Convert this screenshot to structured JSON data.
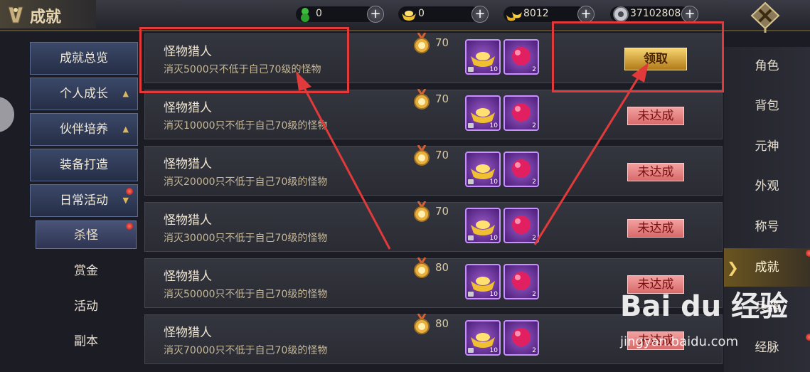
{
  "header": {
    "title": "成就",
    "currencies": [
      {
        "icon": "green-gourd-icon",
        "value": "0"
      },
      {
        "icon": "gold-ingot-icon",
        "value": "0"
      },
      {
        "icon": "gold-ingots-stack-icon",
        "value": "8012"
      },
      {
        "icon": "silver-coin-icon",
        "value": "37102808"
      }
    ],
    "plus_label": "+"
  },
  "left_nav": [
    {
      "label": "成就总览"
    },
    {
      "label": "个人成长",
      "arrow": "▲"
    },
    {
      "label": "伙伴培养",
      "arrow": "▲"
    },
    {
      "label": "装备打造"
    },
    {
      "label": "日常活动",
      "arrow": "▼"
    }
  ],
  "left_sub": [
    {
      "label": "杀怪",
      "active": true
    },
    {
      "label": "赏金"
    },
    {
      "label": "活动"
    },
    {
      "label": "副本"
    }
  ],
  "achievements": [
    {
      "name": "怪物猎人",
      "desc": "消灭5000只不低于自己70级的怪物",
      "points": "70",
      "status": "领取",
      "claimable": true
    },
    {
      "name": "怪物猎人",
      "desc": "消灭10000只不低于自己70级的怪物",
      "points": "70",
      "status": "未达成",
      "claimable": false
    },
    {
      "name": "怪物猎人",
      "desc": "消灭20000只不低于自己70级的怪物",
      "points": "70",
      "status": "未达成",
      "claimable": false
    },
    {
      "name": "怪物猎人",
      "desc": "消灭30000只不低于自己70级的怪物",
      "points": "70",
      "status": "未达成",
      "claimable": false
    },
    {
      "name": "怪物猎人",
      "desc": "消灭50000只不低于自己70级的怪物",
      "points": "80",
      "status": "未达成",
      "claimable": false
    },
    {
      "name": "怪物猎人",
      "desc": "消灭70000只不低于自己70级的怪物",
      "points": "80",
      "status": "未达成",
      "claimable": false
    }
  ],
  "reward_counts": [
    "10",
    "2"
  ],
  "right_nav": [
    {
      "label": "角色"
    },
    {
      "label": "背包"
    },
    {
      "label": "元神"
    },
    {
      "label": "外观"
    },
    {
      "label": "称号"
    },
    {
      "label": "成就",
      "active": true
    },
    {
      "label": "兵器"
    },
    {
      "label": "经脉"
    }
  ],
  "watermark": {
    "logo": "Bai du 经验",
    "url": "jingyan.baidu.com"
  },
  "colors": {
    "annotation": "#e23a3a",
    "claim": "#f0c050",
    "unmet": "#e88080",
    "nav_active": "#6a5420"
  }
}
